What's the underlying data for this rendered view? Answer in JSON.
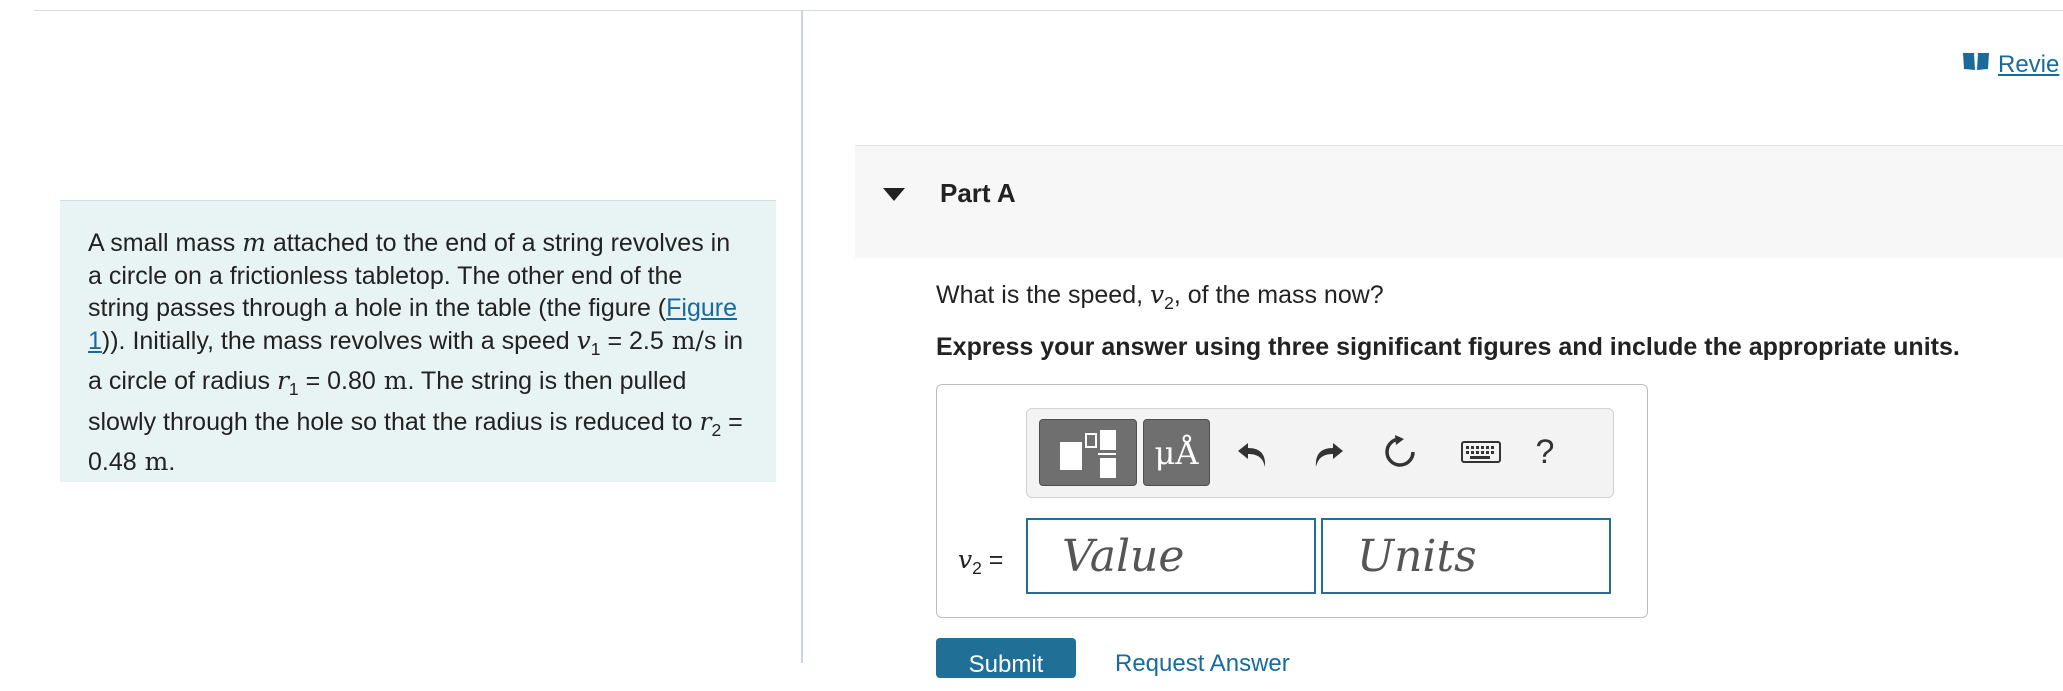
{
  "review": {
    "label": "Revie"
  },
  "problem": {
    "t1": "A small mass ",
    "m": "m",
    "t2": " attached to the end of a string revolves in a circle on a frictionless tabletop. The other end of the string passes through a hole in the table (the figure (",
    "figure_link": "Figure 1",
    "t3": ")). Initially, the mass revolves with a speed ",
    "v": "v",
    "one": "1",
    "eq": " = ",
    "v1_value": "2.5",
    "unit_ms": " m/s",
    "t4": " in a circle of radius ",
    "r": "r",
    "r1_value": "0.80",
    "unit_m": " m",
    "t5": ". The string is then pulled slowly through the hole so that the radius is reduced to ",
    "two": "2",
    "r2_value": "0.48",
    "end": "."
  },
  "part": {
    "title": "Part A"
  },
  "question": {
    "pre": "What is the speed, ",
    "v": "v",
    "sub": "2",
    "post": ", of the mass now?",
    "instruction": "Express your answer using three significant figures and include the appropriate units."
  },
  "answer": {
    "label_var": "v",
    "label_sub": "2",
    "label_eq": " =",
    "value_placeholder": "Value",
    "units_placeholder": "Units",
    "symbols_label": "μÅ",
    "help_label": "?"
  },
  "actions": {
    "submit": "Submit",
    "request": "Request Answer"
  },
  "icons": {
    "toggle": "triangle-down-icon",
    "book": "book-icon",
    "templates": "templates-icon",
    "undo": "undo-icon",
    "redo": "redo-icon",
    "reset": "reset-icon",
    "keyboard": "keyboard-icon"
  }
}
